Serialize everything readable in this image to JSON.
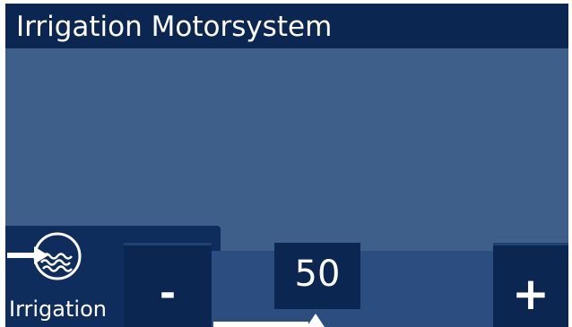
{
  "header": {
    "title": "Irrigation Motorsystem"
  },
  "mode": {
    "label": "Irrigation",
    "icon": "irrigation-icon"
  },
  "control": {
    "minus_label": "-",
    "plus_label": "+",
    "value": "50",
    "level_percent": 50
  },
  "colors": {
    "background": "#3e5f8a",
    "header": "#0b2650",
    "tile": "#0e2d5c",
    "control_bar": "#2b4d80",
    "text": "#ffffff"
  }
}
